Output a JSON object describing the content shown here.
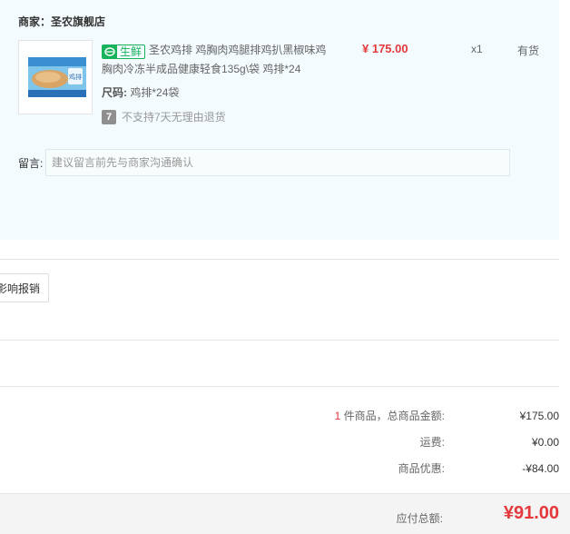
{
  "shop": {
    "seller_label": "商家：",
    "seller_name": "圣农旗舰店"
  },
  "product": {
    "tag": "生鲜",
    "title": "圣农鸡排 鸡胸肉鸡腿排鸡扒黑椒味鸡胸肉冷冻半成品健康轻食135g\\袋 鸡排*24",
    "spec_label": "尺码:",
    "spec_value": "鸡排*24袋",
    "return_badge": "7",
    "return_policy": "不支持7天无理由退货",
    "price": "¥ 175.00",
    "quantity": "x1",
    "stock": "有货",
    "thumb_package_text": "鸡排"
  },
  "remark": {
    "label": "留言:",
    "placeholder": "建议留言前先与商家沟通确认"
  },
  "invoice": {
    "button_label": "影响报销"
  },
  "summary": {
    "item_count": "1",
    "items_label": "件商品，总商品金额:",
    "items_total": "¥175.00",
    "shipping_label": "运费:",
    "shipping_value": "¥0.00",
    "discount_label": "商品优惠:",
    "discount_value": "-¥84.00",
    "payable_label": "应付总额:",
    "payable_value": "¥91.00"
  },
  "colors": {
    "price_red": "#e4393c",
    "fresh_green": "#16b35a",
    "panel_bg": "#f3fbfe"
  }
}
